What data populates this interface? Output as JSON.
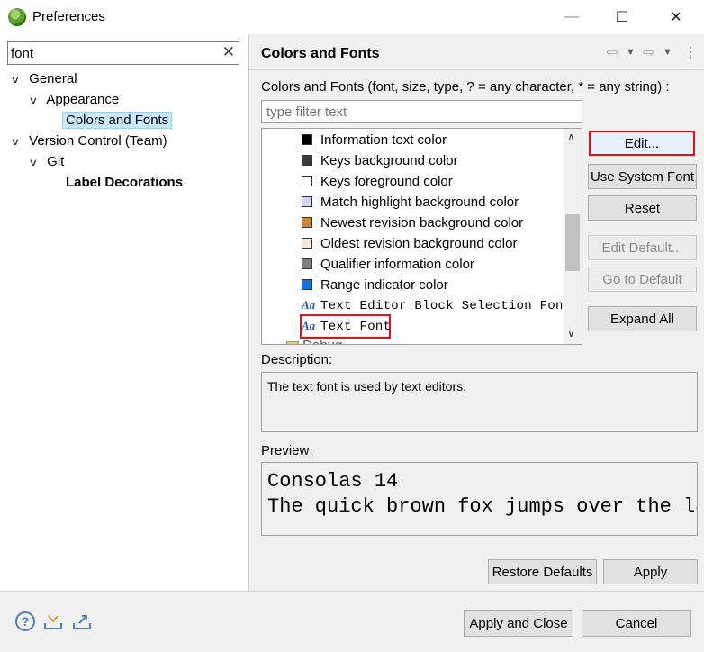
{
  "window": {
    "title": "Preferences"
  },
  "sidebar": {
    "filter_value": "font",
    "tree": {
      "general": "General",
      "appearance": "Appearance",
      "colors_and_fonts": "Colors and Fonts",
      "version_control": "Version Control (Team)",
      "git": "Git",
      "label_decorations": "Label Decorations"
    }
  },
  "page": {
    "title": "Colors and Fonts",
    "description": "Colors and Fonts (font, size, type, ? = any character, * = any string) :",
    "filter_placeholder": "type filter text",
    "items": [
      {
        "label": "Information text color",
        "kind": "color",
        "color": "#000000"
      },
      {
        "label": "Keys background color",
        "kind": "color",
        "color": "#3c3c3c"
      },
      {
        "label": "Keys foreground color",
        "kind": "color",
        "color": "#ffffff"
      },
      {
        "label": "Match highlight background color",
        "kind": "color",
        "color": "#d4d4f5"
      },
      {
        "label": "Newest revision background color",
        "kind": "color",
        "color": "#c8883c"
      },
      {
        "label": "Oldest revision background color",
        "kind": "color",
        "color": "#f7e6dc"
      },
      {
        "label": "Qualifier information color",
        "kind": "color",
        "color": "#808080"
      },
      {
        "label": "Range indicator color",
        "kind": "color",
        "color": "#1474dc"
      },
      {
        "label": "Text Editor Block Selection Font",
        "kind": "font"
      },
      {
        "label": "Text Font",
        "kind": "font",
        "selected": true
      },
      {
        "label": "Debug",
        "kind": "folder"
      }
    ],
    "buttons": {
      "edit": "Edit...",
      "use_system_font": "Use System Font",
      "reset": "Reset",
      "edit_default": "Edit Default...",
      "go_to_default": "Go to Default",
      "expand_all": "Expand All"
    },
    "description_label": "Description:",
    "description_text": "The text font is used by text editors.",
    "preview_label": "Preview:",
    "preview_line1": "Consolas 14",
    "preview_line2": "The quick brown fox jumps over the la",
    "restore_defaults": "Restore Defaults",
    "apply": "Apply"
  },
  "footer": {
    "apply_and_close": "Apply and Close",
    "cancel": "Cancel"
  },
  "colors": {
    "highlight_red": "#e0101e",
    "selection_bg": "#cce8ff",
    "accent_blue": "#4d7fb8"
  }
}
